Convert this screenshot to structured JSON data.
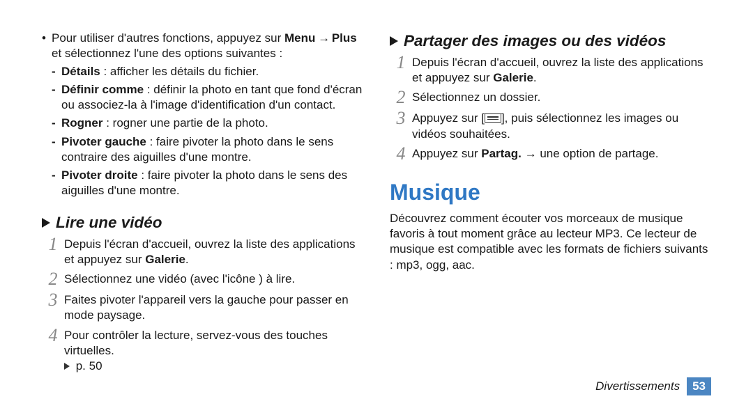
{
  "left": {
    "intro": {
      "pre": "Pour utiliser d'autres fonctions, appuyez sur ",
      "menu": "Menu",
      "arrow": " → ",
      "plus": "Plus",
      "post": " et sélectionnez l'une des options suivantes :"
    },
    "subs": [
      {
        "term": "Détails",
        "desc": " : afficher les détails du fichier."
      },
      {
        "term": "Définir comme",
        "desc": " : définir la photo en tant que fond d'écran ou associez-la à l'image d'identification d'un contact."
      },
      {
        "term": "Rogner",
        "desc": " : rogner une partie de la photo."
      },
      {
        "term": "Pivoter gauche",
        "desc": " : faire pivoter la photo dans le sens contraire des aiguilles d'une montre."
      },
      {
        "term": "Pivoter droite",
        "desc": " : faire pivoter la photo dans le sens des aiguilles d'une montre."
      }
    ],
    "video": {
      "title": "Lire une vidéo",
      "steps": {
        "s1a": "Depuis l'écran d'accueil, ouvrez la liste des applications et appuyez sur ",
        "s1b": "Galerie",
        "s1c": ".",
        "s2": "Sélectionnez une vidéo (avec l'icône        ) à lire.",
        "s3": "Faites pivoter l'appareil vers la gauche pour passer en mode paysage.",
        "s4": "Pour contrôler la lecture, servez-vous des touches virtuelles.",
        "s4ref": " p. 50"
      }
    }
  },
  "right": {
    "share": {
      "title": "Partager des images ou des vidéos",
      "s1a": "Depuis l'écran d'accueil, ouvrez la liste des applications et appuyez sur ",
      "s1b": "Galerie",
      "s1c": ".",
      "s2": "Sélectionnez un dossier.",
      "s3a": "Appuyez sur [",
      "s3b": "], puis sélectionnez les images ou vidéos souhaitées.",
      "s4a": "Appuyez sur ",
      "s4b": "Partag.",
      "s4c": " → une option de partage."
    },
    "music": {
      "title": "Musique",
      "body": "Découvrez comment écouter vos morceaux de musique favoris à tout moment grâce au lecteur MP3. Ce lecteur de musique est compatible avec les formats de fichiers suivants : mp3, ogg, aac."
    }
  },
  "footer": {
    "section": "Divertissements",
    "page": "53"
  },
  "nums": {
    "n1": "1",
    "n2": "2",
    "n3": "3",
    "n4": "4"
  },
  "sym": {
    "bullet": "•",
    "dash": "-"
  }
}
